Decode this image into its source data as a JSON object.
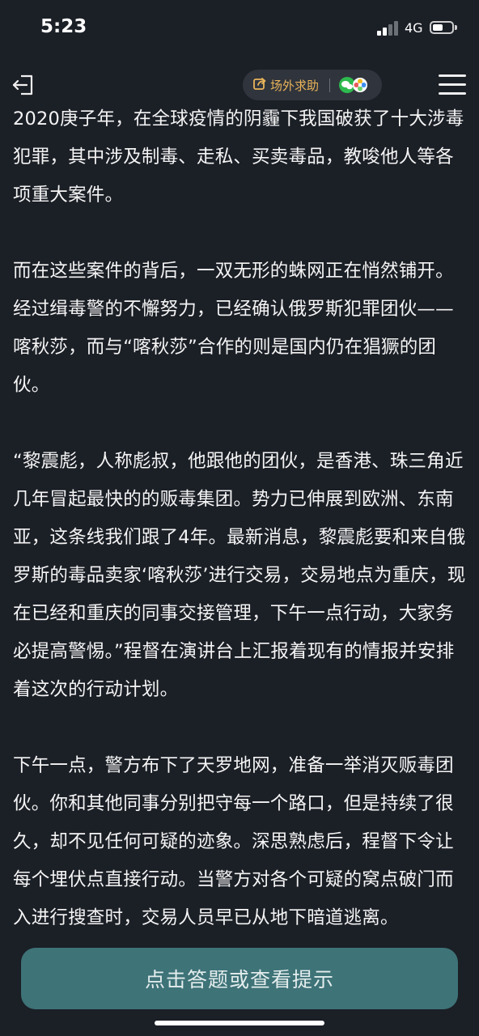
{
  "status_bar": {
    "time": "5:23",
    "network": "4G",
    "signal_bars": 2,
    "signal_bars_total": 4,
    "battery_level": 0.55
  },
  "nav": {
    "exit_icon": "exit-icon",
    "help_label": "场外求助",
    "help_icon": "share-icon",
    "share_icons": [
      "wechat-icon",
      "moments-icon"
    ],
    "menu_icon": "hamburger-menu-icon",
    "accent_color": "#e9b45a"
  },
  "story": {
    "paragraphs": [
      "2020庚子年，在全球疫情的阴霾下我国破获了十大涉毒犯罪，其中涉及制毒、走私、买卖毒品，教唆他人等各项重大案件。",
      "而在这些案件的背后，一双无形的蛛网正在悄然铺开。经过缉毒警的不懈努力，已经确认俄罗斯犯罪团伙——喀秋莎，而与“喀秋莎”合作的则是国内仍在猖獗的团伙。",
      "“黎震彪，人称彪叔，他跟他的团伙，是香港、珠三角近几年冒起最快的的贩毒集团。势力已伸展到欧洲、东南亚，这条线我们跟了4年。最新消息，黎震彪要和来自俄罗斯的毒品卖家‘喀秋莎’进行交易，交易地点为重庆，现在已经和重庆的同事交接管理，下午一点行动，大家务必提高警惕。”程督在演讲台上汇报着现有的情报并安排着这次的行动计划。",
      "下午一点，警方布下了天罗地网，准备一举消灭贩毒团伙。你和其他同事分别把守每一个路口，但是持续了很久，却不见任何可疑的迹象。深思熟虑后，程督下令让每个埋伏点直接行动。当警方对各个可疑的窝点破门而入进行搜查时，交易人员早已从地下暗道逃离。"
    ]
  },
  "action": {
    "label": "点击答题或查看提示",
    "color": "#3e7378"
  }
}
